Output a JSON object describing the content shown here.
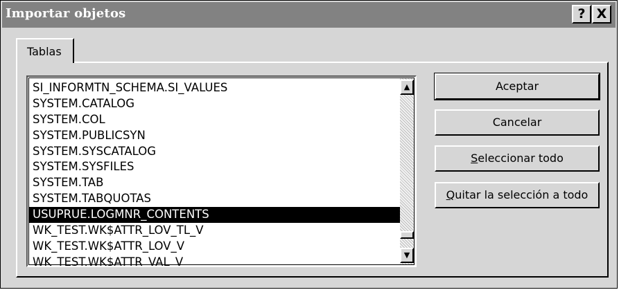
{
  "window": {
    "title": "Importar objetos",
    "help_glyph": "?",
    "close_glyph": "X"
  },
  "tabs": [
    {
      "label": "Tablas",
      "selected": true
    }
  ],
  "list": {
    "items": [
      "SI_INFORMTN_SCHEMA.SI_VALUES",
      "SYSTEM.CATALOG",
      "SYSTEM.COL",
      "SYSTEM.PUBLICSYN",
      "SYSTEM.SYSCATALOG",
      "SYSTEM.SYSFILES",
      "SYSTEM.TAB",
      "SYSTEM.TABQUOTAS",
      "USUPRUE.LOGMNR_CONTENTS",
      "WK_TEST.WK$ATTR_LOV_TL_V",
      "WK_TEST.WK$ATTR_LOV_V",
      "WK_TEST.WK$ATTR_VAL_V"
    ],
    "selected_index": 8,
    "scroll_position": 0.94
  },
  "buttons": {
    "accept": "Aceptar",
    "cancel": "Cancelar",
    "select_all_mnemonic": "S",
    "select_all_rest": "eleccionar todo",
    "deselect_all_mnemonic": "Q",
    "deselect_all_rest": "uitar la selección a todo"
  },
  "colors": {
    "face": "#d6d6d6",
    "titlebar": "#828282",
    "selection": "#000000"
  }
}
